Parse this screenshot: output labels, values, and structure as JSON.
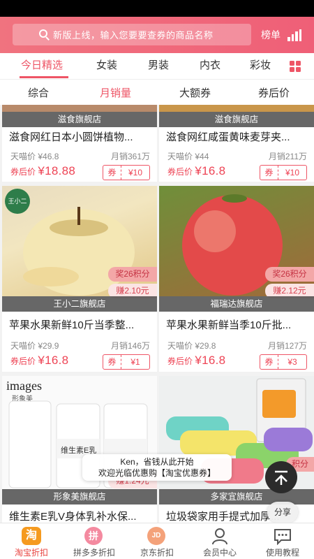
{
  "header": {
    "search_placeholder": "新版上线，输入您要要查券的商品名称",
    "rank_label": "榜单"
  },
  "category_tabs": [
    {
      "label": "今日精选",
      "active": true
    },
    {
      "label": "女装",
      "active": false
    },
    {
      "label": "男装",
      "active": false
    },
    {
      "label": "内衣",
      "active": false
    },
    {
      "label": "彩妆",
      "active": false
    }
  ],
  "sort_tabs": [
    {
      "label": "综合",
      "active": false
    },
    {
      "label": "月销量",
      "active": true
    },
    {
      "label": "大额券",
      "active": false
    },
    {
      "label": "券后价",
      "active": false
    }
  ],
  "products": [
    {
      "shop": "滋食旗舰店",
      "title": "滋食网红日本小圆饼植物...",
      "tmall_label": "天喵价",
      "tmall_price": "¥46.8",
      "sales_label": "月销",
      "sales": "361万",
      "after_label": "券后价",
      "after_price": "¥18.88",
      "coupon_label": "券",
      "coupon_value": "¥10"
    },
    {
      "shop": "滋食旗舰店",
      "title": "滋食网红咸蛋黄味麦芽夹...",
      "tmall_label": "天喵价",
      "tmall_price": "¥44",
      "sales_label": "月销",
      "sales": "211万",
      "after_label": "券后价",
      "after_price": "¥16.8",
      "coupon_label": "券",
      "coupon_value": "¥10"
    },
    {
      "shop": "王小二旗舰店",
      "title": "苹果水果新鲜10斤当季整...",
      "tmall_label": "天喵价",
      "tmall_price": "¥29.9",
      "sales_label": "月销",
      "sales": "146万",
      "after_label": "券后价",
      "after_price": "¥16.8",
      "coupon_label": "券",
      "coupon_value": "¥1",
      "reward": "奖26积分",
      "earn": "赚2.10元",
      "brand_mark": "王小二"
    },
    {
      "shop": "福瑞达旗舰店",
      "title": "苹果水果新鲜当季10斤批...",
      "tmall_label": "天喵价",
      "tmall_price": "¥29.8",
      "sales_label": "月销",
      "sales": "127万",
      "after_label": "券后价",
      "after_price": "¥16.8",
      "coupon_label": "券",
      "coupon_value": "¥3",
      "reward": "奖26积分",
      "earn": "赚2.12元"
    },
    {
      "shop": "形象美旗舰店",
      "title": "维生素E乳V身体乳补水保...",
      "brand": "images",
      "brand_sub": "形象美",
      "bottle_label": "维生素E乳",
      "earn": "赚1.24元"
    },
    {
      "shop": "多家宜旗舰店",
      "title": "垃圾袋家用手提式加厚...",
      "reward": "积分"
    }
  ],
  "toast": {
    "line1": "Ken，省钱从此开始",
    "line2": "欢迎光临优惠购【淘宝优惠券】"
  },
  "share_label": "分享",
  "bottom_nav": [
    {
      "label": "淘宝折扣",
      "icon": "taobao-icon",
      "glyph": "淘",
      "active": true
    },
    {
      "label": "拼多多折扣",
      "icon": "pinduoduo-icon",
      "glyph": "拼",
      "active": false
    },
    {
      "label": "京东折扣",
      "icon": "jd-icon",
      "glyph": "JD",
      "active": false
    },
    {
      "label": "会员中心",
      "icon": "user-icon",
      "active": false
    },
    {
      "label": "使用教程",
      "icon": "message-icon",
      "active": false
    }
  ],
  "colors": {
    "accent": "#ee5566",
    "header_gradient_start": "#f0737f",
    "header_gradient_end": "#ef5f77",
    "price_red": "#ee4455"
  }
}
